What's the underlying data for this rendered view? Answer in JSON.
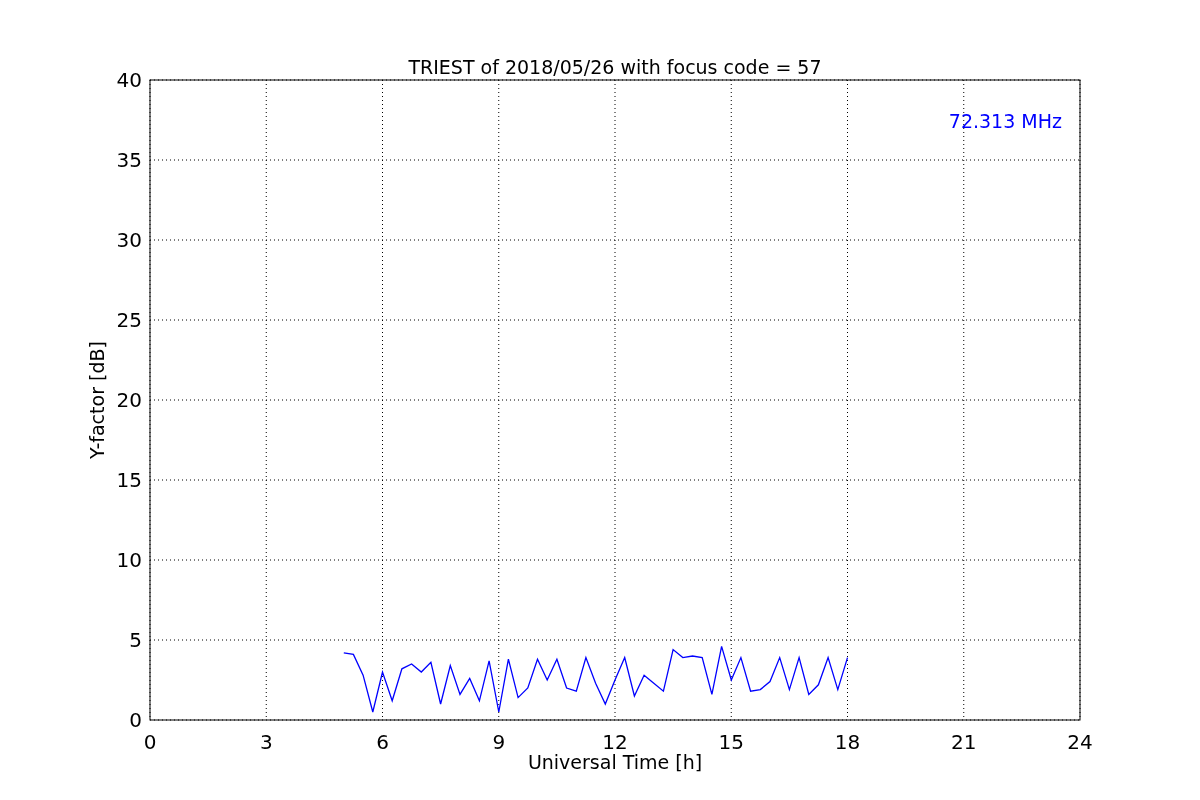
{
  "chart_data": {
    "type": "line",
    "title": "TRIEST of 2018/05/26 with focus code = 57",
    "xlabel": "Universal Time [h]",
    "ylabel": "Y-factor [dB]",
    "x": [
      5,
      5.25,
      5.5,
      5.75,
      6,
      6.25,
      6.5,
      6.75,
      7,
      7.25,
      7.5,
      7.75,
      8,
      8.25,
      8.5,
      8.75,
      9,
      9.25,
      9.5,
      9.75,
      10,
      10.25,
      10.5,
      10.75,
      11,
      11.25,
      11.5,
      11.75,
      12,
      12.25,
      12.5,
      12.75,
      13,
      13.25,
      13.5,
      13.75,
      14,
      14.25,
      14.5,
      14.75,
      15,
      15.25,
      15.5,
      15.75,
      16,
      16.25,
      16.5,
      16.75,
      17,
      17.25,
      17.5,
      17.75,
      18
    ],
    "series": [
      {
        "name": "72.313 MHz",
        "color": "#0000ff",
        "values": [
          4.2,
          4.1,
          2.8,
          0.5,
          3.0,
          1.2,
          3.2,
          3.5,
          3.0,
          3.6,
          1.0,
          3.4,
          1.6,
          2.6,
          1.2,
          3.7,
          0.5,
          3.8,
          1.4,
          2.0,
          3.8,
          2.5,
          3.8,
          2.0,
          1.8,
          3.9,
          2.3,
          1.0,
          2.5,
          3.9,
          1.5,
          2.8,
          2.3,
          1.8,
          4.4,
          3.9,
          4.0,
          3.9,
          1.6,
          4.6,
          2.5,
          3.9,
          1.8,
          1.9,
          2.4,
          3.9,
          1.9,
          3.9,
          1.6,
          2.2,
          3.9,
          1.9,
          3.9
        ]
      }
    ],
    "xlim": [
      0,
      24
    ],
    "ylim": [
      0,
      40
    ],
    "xticks": [
      0,
      3,
      6,
      9,
      12,
      15,
      18,
      21,
      24
    ],
    "yticks": [
      0,
      5,
      10,
      15,
      20,
      25,
      30,
      35,
      40
    ],
    "grid": true
  }
}
